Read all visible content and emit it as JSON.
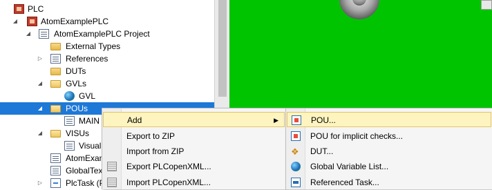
{
  "tree": {
    "items": [
      {
        "label": "PLC",
        "icon": "plc-icon",
        "expander": ""
      },
      {
        "label": "AtomExamplePLC",
        "icon": "plc-project-icon",
        "expander": "◢"
      },
      {
        "label": "AtomExamplePLC Project",
        "icon": "project-icon",
        "expander": "◢"
      },
      {
        "label": "External Types",
        "icon": "folder-icon",
        "expander": ""
      },
      {
        "label": "References",
        "icon": "references-icon",
        "expander": "▷"
      },
      {
        "label": "DUTs",
        "icon": "folder-icon",
        "expander": ""
      },
      {
        "label": "GVLs",
        "icon": "folder-open-icon",
        "expander": "◢"
      },
      {
        "label": "GVL",
        "icon": "globe-icon",
        "expander": ""
      },
      {
        "label": "POUs",
        "icon": "folder-open-icon",
        "expander": "◢"
      },
      {
        "label": "MAIN",
        "icon": "program-icon",
        "expander": ""
      },
      {
        "label": "VISUs",
        "icon": "folder-open-icon",
        "expander": "◢"
      },
      {
        "label": "Visuali",
        "icon": "visualization-icon",
        "expander": ""
      },
      {
        "label": "AtomExam",
        "icon": "instance-icon",
        "expander": ""
      },
      {
        "label": "GlobalTex",
        "icon": "text-list-icon",
        "expander": ""
      },
      {
        "label": "PlcTask (P",
        "icon": "task-icon",
        "expander": "▷"
      }
    ]
  },
  "context_menu": {
    "items": [
      {
        "label": "Add",
        "has_submenu": true,
        "icon": ""
      },
      {
        "label": "Export to ZIP",
        "has_submenu": false,
        "icon": ""
      },
      {
        "label": "Import from ZIP",
        "has_submenu": false,
        "icon": ""
      },
      {
        "label": "Export PLCopenXML...",
        "has_submenu": false,
        "icon": "xml-export-icon"
      },
      {
        "label": "Import PLCopenXML...",
        "has_submenu": false,
        "icon": "xml-import-icon"
      }
    ],
    "submenu_arrow": "▶"
  },
  "submenu": {
    "items": [
      {
        "label": "POU...",
        "icon": "pou-icon"
      },
      {
        "label": "POU for implicit checks...",
        "icon": "pou-checks-icon"
      },
      {
        "label": "DUT...",
        "icon": "dut-icon"
      },
      {
        "label": "Global Variable List...",
        "icon": "gvl-icon"
      },
      {
        "label": "Referenced Task...",
        "icon": "referenced-task-icon"
      }
    ]
  },
  "colors": {
    "selection": "#1e78d7",
    "menu_highlight": "#fdf4bf",
    "visualization_background": "#00c400"
  }
}
